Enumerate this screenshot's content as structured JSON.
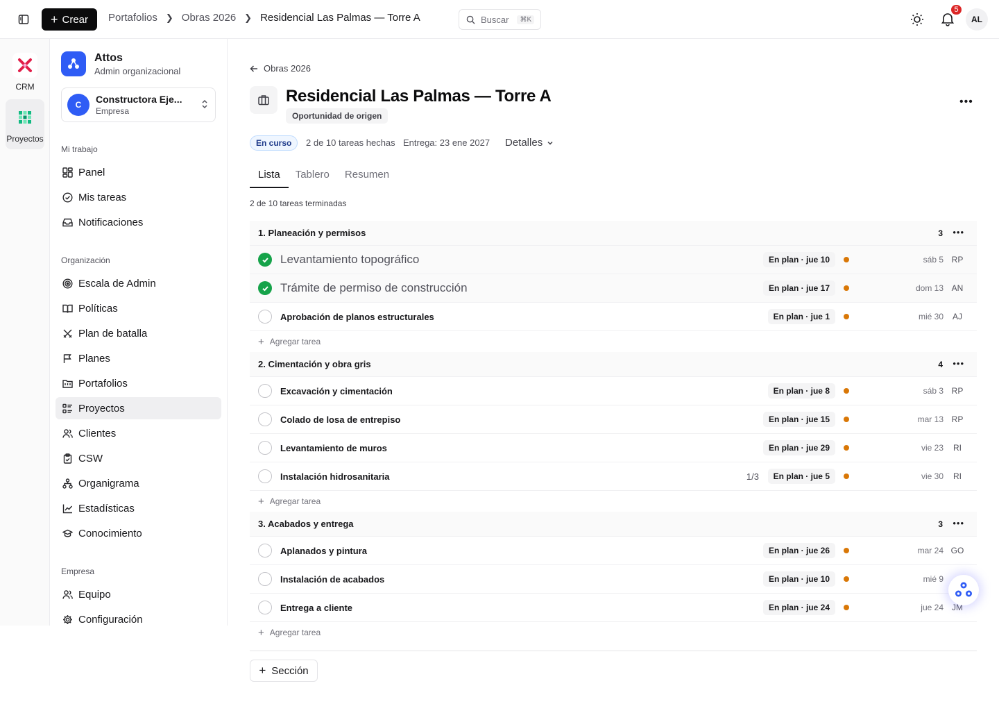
{
  "topbar": {
    "create_label": "Crear",
    "breadcrumb": [
      "Portafolios",
      "Obras 2026",
      "Residencial Las Palmas — Torre A"
    ],
    "search_placeholder": "Buscar",
    "search_shortcut": "⌘K",
    "notifications_count": "5",
    "user_initials": "AL"
  },
  "rail": {
    "items": [
      {
        "label": "CRM",
        "icon": "crm-x-icon",
        "color": "#e11d48"
      },
      {
        "label": "Proyectos",
        "icon": "projects-grid-icon",
        "color": "#10b981"
      }
    ]
  },
  "sidebar": {
    "org_name": "Attos",
    "org_role": "Admin organizacional",
    "company_initial": "C",
    "company_name": "Constructora Eje...",
    "company_type": "Empresa",
    "sections": [
      {
        "title": "Mi trabajo",
        "items": [
          {
            "label": "Panel",
            "icon": "dashboard-icon"
          },
          {
            "label": "Mis tareas",
            "icon": "check-circle-icon"
          },
          {
            "label": "Notificaciones",
            "icon": "inbox-icon"
          }
        ]
      },
      {
        "title": "Organización",
        "items": [
          {
            "label": "Escala de Admin",
            "icon": "target-icon"
          },
          {
            "label": "Políticas",
            "icon": "book-icon"
          },
          {
            "label": "Plan de batalla",
            "icon": "crossed-swords-icon"
          },
          {
            "label": "Planes",
            "icon": "flag-icon"
          },
          {
            "label": "Portafolios",
            "icon": "folder-icon"
          },
          {
            "label": "Proyectos",
            "icon": "list-icon"
          },
          {
            "label": "Clientes",
            "icon": "users-icon"
          },
          {
            "label": "CSW",
            "icon": "clipboard-icon"
          },
          {
            "label": "Organigrama",
            "icon": "org-chart-icon"
          },
          {
            "label": "Estadísticas",
            "icon": "chart-line-icon"
          },
          {
            "label": "Conocimiento",
            "icon": "graduation-cap-icon"
          }
        ]
      },
      {
        "title": "Empresa",
        "items": [
          {
            "label": "Equipo",
            "icon": "users-icon"
          },
          {
            "label": "Configuración",
            "icon": "settings-gear-icon"
          }
        ]
      }
    ],
    "active_item": "Proyectos"
  },
  "main": {
    "back_label": "Obras 2026",
    "title": "Residencial Las Palmas — Torre A",
    "origin_tag": "Oportunidad de origen",
    "status": "En curso",
    "tasks_done": "2 de 10 tareas hechas",
    "delivery": "Entrega: 23 ene 2027",
    "details_label": "Detalles",
    "tabs": [
      "Lista",
      "Tablero",
      "Resumen"
    ],
    "active_tab": "Lista",
    "progress_text": "2 de 10 tareas terminadas",
    "add_task_label": "Agregar tarea",
    "add_section_label": "Sección",
    "sections": [
      {
        "title": "1. Planeación y permisos",
        "count": "3",
        "tasks": [
          {
            "name": "Levantamiento topográfico",
            "done": true,
            "plan": "En plan · jue 10",
            "due": "sáb 5",
            "assignee": "RP",
            "subtasks": ""
          },
          {
            "name": "Trámite de permiso de construcción",
            "done": true,
            "plan": "En plan · jue 17",
            "due": "dom 13",
            "assignee": "AN",
            "subtasks": ""
          },
          {
            "name": "Aprobación de planos estructurales",
            "done": false,
            "plan": "En plan · jue 1",
            "due": "mié 30",
            "assignee": "AJ",
            "subtasks": ""
          }
        ]
      },
      {
        "title": "2. Cimentación y obra gris",
        "count": "4",
        "tasks": [
          {
            "name": "Excavación y cimentación",
            "done": false,
            "plan": "En plan · jue 8",
            "due": "sáb 3",
            "assignee": "RP",
            "subtasks": ""
          },
          {
            "name": "Colado de losa de entrepiso",
            "done": false,
            "plan": "En plan · jue 15",
            "due": "mar 13",
            "assignee": "RP",
            "subtasks": ""
          },
          {
            "name": "Levantamiento de muros",
            "done": false,
            "plan": "En plan · jue 29",
            "due": "vie 23",
            "assignee": "RI",
            "subtasks": ""
          },
          {
            "name": "Instalación hidrosanitaria",
            "done": false,
            "plan": "En plan · jue 5",
            "due": "vie 30",
            "assignee": "RI",
            "subtasks": "1/3"
          }
        ]
      },
      {
        "title": "3. Acabados y entrega",
        "count": "3",
        "tasks": [
          {
            "name": "Aplanados y pintura",
            "done": false,
            "plan": "En plan · jue 26",
            "due": "mar 24",
            "assignee": "GO",
            "subtasks": ""
          },
          {
            "name": "Instalación de acabados",
            "done": false,
            "plan": "En plan · jue 10",
            "due": "mié 9",
            "assignee": "",
            "subtasks": ""
          },
          {
            "name": "Entrega a cliente",
            "done": false,
            "plan": "En plan · jue 24",
            "due": "jue 24",
            "assignee": "JM",
            "subtasks": ""
          }
        ]
      }
    ]
  },
  "colors": {
    "accent": "#2f5cf5",
    "done_green": "#16a34a",
    "priority_dot": "#d97706",
    "badge_red": "#dc2626"
  }
}
